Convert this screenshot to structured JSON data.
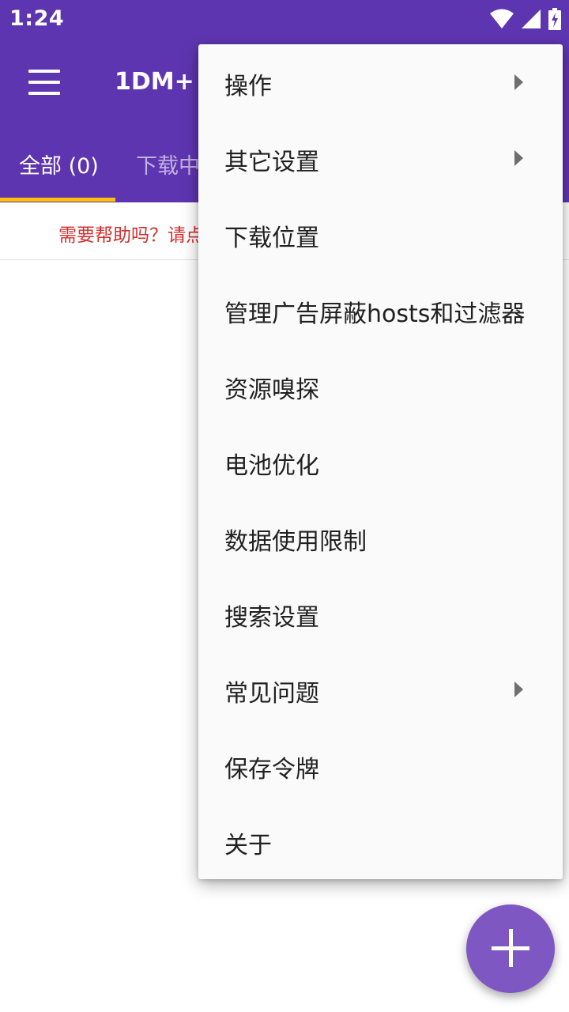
{
  "status_bar": {
    "time": "1:24",
    "icons": [
      "wifi-icon",
      "cell-signal-icon",
      "battery-charging-icon"
    ]
  },
  "app_bar": {
    "title": "1DM+",
    "menu_icon": "hamburger-menu-icon",
    "color": "#5e35b1"
  },
  "tabs": [
    {
      "label": "全部 (0)",
      "selected": true
    },
    {
      "label": "下载中"
    }
  ],
  "help_banner": {
    "text": "需要帮助吗？请点"
  },
  "overflow_menu": {
    "items": [
      {
        "label": "操作",
        "has_submenu": true
      },
      {
        "label": "其它设置",
        "has_submenu": true
      },
      {
        "label": "下载位置",
        "has_submenu": false
      },
      {
        "label": "管理广告屏蔽hosts和过滤器",
        "has_submenu": false
      },
      {
        "label": "资源嗅探",
        "has_submenu": false
      },
      {
        "label": "电池优化",
        "has_submenu": false
      },
      {
        "label": "数据使用限制",
        "has_submenu": false
      },
      {
        "label": "搜索设置",
        "has_submenu": false
      },
      {
        "label": "常见问题",
        "has_submenu": true
      },
      {
        "label": "保存令牌",
        "has_submenu": false
      },
      {
        "label": "关于",
        "has_submenu": false
      }
    ]
  },
  "fab": {
    "icon": "plus-icon",
    "color": "#7e57c2"
  },
  "colors": {
    "primary": "#5e35b1",
    "accent": "#ffc107",
    "help_text": "#d32f2f"
  }
}
